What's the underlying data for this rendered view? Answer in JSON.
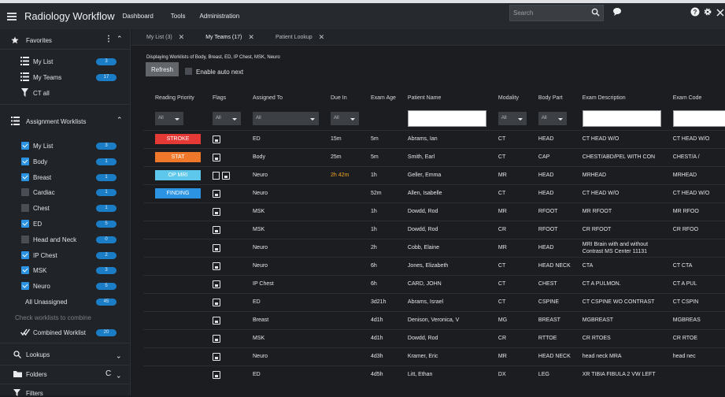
{
  "header": {
    "app_title": "Radiology Workflow",
    "nav": [
      "Dashboard",
      "Tools",
      "Administration"
    ],
    "search_placeholder": "Search"
  },
  "sidebar": {
    "favorites_title": "Favorites",
    "favorites": [
      {
        "label": "My List",
        "count": "3"
      },
      {
        "label": "My Teams",
        "count": "17"
      },
      {
        "label": "CT all"
      }
    ],
    "assignment_title": "Assignment Worklists",
    "worklists": [
      {
        "label": "My List",
        "checked": true,
        "count": "3"
      },
      {
        "label": "Body",
        "checked": true,
        "count": "1"
      },
      {
        "label": "Breast",
        "checked": true,
        "count": "1"
      },
      {
        "label": "Cardiac",
        "checked": false,
        "count": "1"
      },
      {
        "label": "Chest",
        "checked": false,
        "count": "1"
      },
      {
        "label": "ED",
        "checked": true,
        "count": "5"
      },
      {
        "label": "Head and Neck",
        "checked": false,
        "count": "0"
      },
      {
        "label": "IP Chest",
        "checked": true,
        "count": "2"
      },
      {
        "label": "MSK",
        "checked": true,
        "count": "3"
      },
      {
        "label": "Neuro",
        "checked": true,
        "count": "5"
      }
    ],
    "all_unassigned": {
      "label": "All Unassigned",
      "count": "45"
    },
    "combine_hint": "Check worklists to combine",
    "combined": {
      "label": "Combined Worklist",
      "count": "20"
    },
    "lookups": "Lookups",
    "folders": "Folders",
    "filters": "Filters"
  },
  "tabs": [
    {
      "label": "My List (3)"
    },
    {
      "label": "My Teams (17)"
    },
    {
      "label": "Patient Lookup"
    }
  ],
  "toolbar": {
    "info": "Displaying Worklists of Body, Breast, ED, IP Chest, MSK, Neuro",
    "refresh": "Refresh",
    "auto_next": "Enable auto next"
  },
  "table": {
    "columns": [
      "Reading Priority",
      "Flags",
      "Assigned To",
      "Due In",
      "Exam Age",
      "Patient Name",
      "Modality",
      "Body Part",
      "Exam Description",
      "Exam Code"
    ],
    "filter_all": "All",
    "rows": [
      {
        "priority": "STROKE",
        "priority_color": "#e53935",
        "flags": 1,
        "assigned": "ED",
        "due": "15m",
        "age": "5m",
        "patient": "Abrams, Ian",
        "modality": "CT",
        "body": "HEAD",
        "desc": "CT HEAD W/O",
        "code": "CT HEAD W/O"
      },
      {
        "priority": "STAT",
        "priority_color": "#f0782a",
        "flags": 1,
        "assigned": "Body",
        "due": "25m",
        "age": "5m",
        "patient": "Smith, Earl",
        "modality": "CT",
        "body": "CAP",
        "desc": "CHEST/ABD/PEL WITH CON",
        "code": "CHEST/A /"
      },
      {
        "priority": "OP MRI",
        "priority_color": "#5ec8ec",
        "flags": 2,
        "assigned": "Neuro",
        "due": "2h 42m",
        "due_color": "orange",
        "age": "1h",
        "patient": "Geller, Emma",
        "modality": "MR",
        "body": "HEAD",
        "desc": "MRHEAD",
        "code": "MRHEAD"
      },
      {
        "priority": "FINDING",
        "priority_color": "#2b93e2",
        "flags": 1,
        "assigned": "Neuro",
        "due": "",
        "age": "52m",
        "patient": "Allen, Isabelle",
        "modality": "CT",
        "body": "HEAD",
        "desc": "CT HEAD W/O",
        "code": "CT HEAD W/O"
      },
      {
        "priority": "",
        "flags": 1,
        "assigned": "MSK",
        "due": "",
        "age": "1h",
        "patient": "Dowdd, Rod",
        "modality": "MR",
        "body": "RFOOT",
        "desc": "MR RFOOT",
        "code": "MR RFOO"
      },
      {
        "priority": "",
        "flags": 1,
        "assigned": "MSK",
        "due": "",
        "age": "1h",
        "patient": "Dowdd, Rod",
        "modality": "CR",
        "body": "RFOOT",
        "desc": "CR RFOOT",
        "code": "CR RFOO"
      },
      {
        "priority": "",
        "flags": 1,
        "assigned": "Neuro",
        "due": "",
        "age": "2h",
        "patient": "Cobb, Elaine",
        "modality": "MR",
        "body": "HEAD",
        "desc": "MRI Brain with and without Contrast MS Center 11131",
        "code": ""
      },
      {
        "priority": "",
        "flags": 1,
        "assigned": "Neuro",
        "due": "",
        "age": "6h",
        "patient": "Jones, Elizabeth",
        "modality": "CT",
        "body": "HEAD NECK",
        "desc": "CTA",
        "code": "CT CTA"
      },
      {
        "priority": "",
        "flags": 1,
        "assigned": "IP Chest",
        "due": "",
        "age": "6h",
        "patient": "CARD, JOHN",
        "modality": "CT",
        "body": "CHEST",
        "desc": "CT A PULMON.",
        "code": "CT A PUL"
      },
      {
        "priority": "",
        "flags": 1,
        "assigned": "ED",
        "due": "",
        "age": "3d21h",
        "patient": "Abrams, Israel",
        "modality": "CT",
        "body": "CSPINE",
        "desc": "CT CSPINE WO CONTRAST",
        "code": "CT CSPIN"
      },
      {
        "priority": "",
        "flags": 1,
        "assigned": "Breast",
        "due": "",
        "age": "4d1h",
        "patient": "Denison, Veronica, V",
        "modality": "MG",
        "body": "BREAST",
        "desc": "MGBREAST",
        "code": "MGBREAS"
      },
      {
        "priority": "",
        "flags": 1,
        "assigned": "MSK",
        "due": "",
        "age": "4d1h",
        "patient": "Dowdd, Rod",
        "modality": "CR",
        "body": "RTTOE",
        "desc": "CR RTOES",
        "code": "CR RTOE"
      },
      {
        "priority": "",
        "flags": 1,
        "assigned": "Neuro",
        "due": "",
        "age": "4d3h",
        "patient": "Kramer, Eric",
        "modality": "MR",
        "body": "HEAD NECK",
        "desc": "head neck MRA",
        "code": "head nec"
      },
      {
        "priority": "",
        "flags": 1,
        "assigned": "ED",
        "due": "",
        "age": "4d5h",
        "patient": "Litt, Ethan",
        "modality": "DX",
        "body": "LEG",
        "desc": "XR TIBIA FIBULA 2 VW LEFT",
        "code": ""
      }
    ]
  }
}
